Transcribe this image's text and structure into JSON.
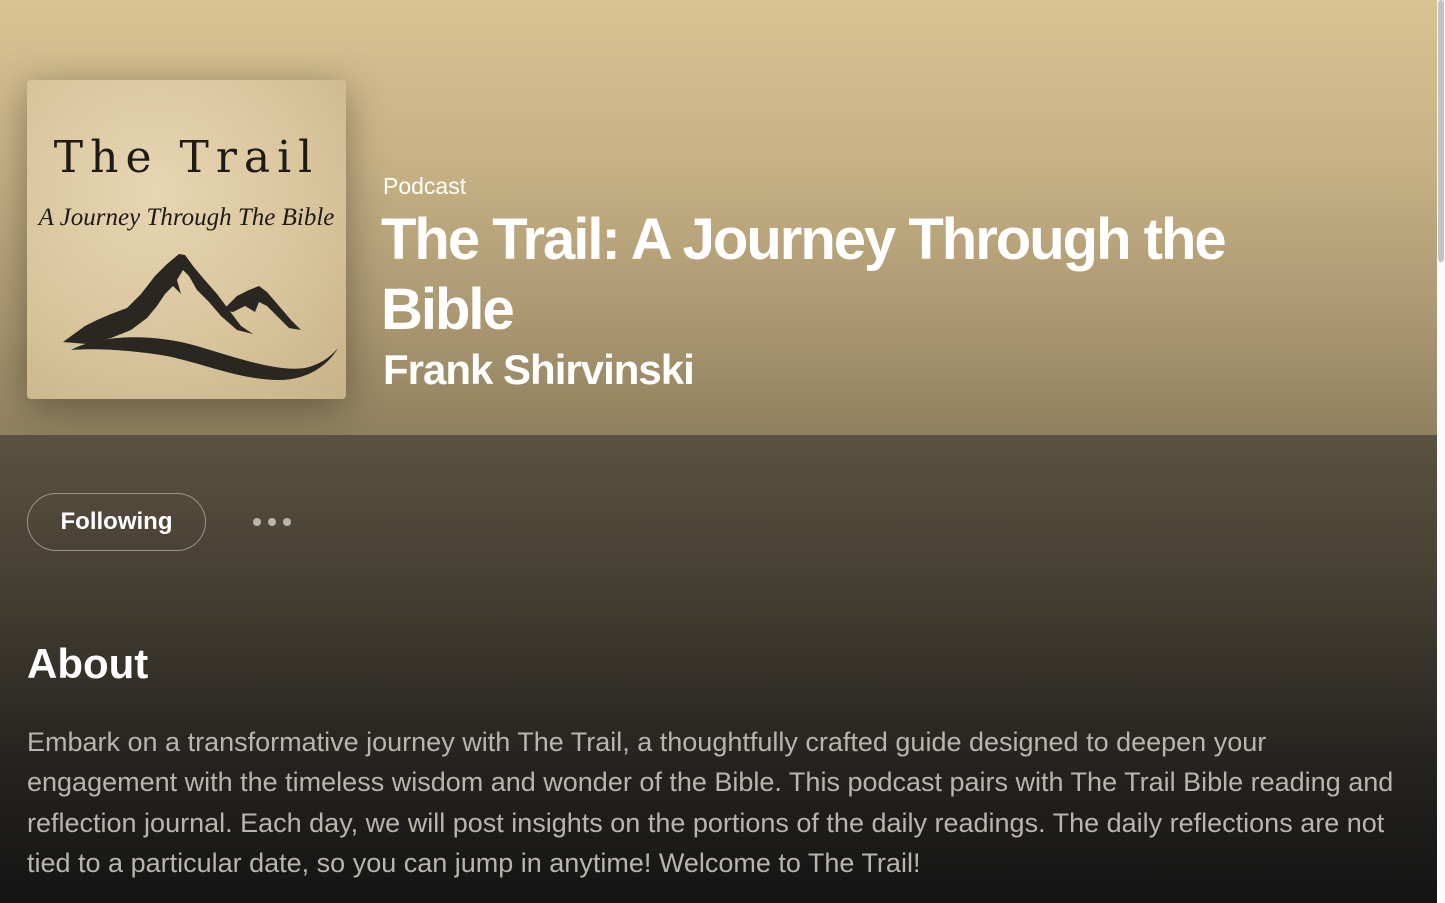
{
  "header": {
    "type_label": "Podcast",
    "title": "The Trail: A Journey Through the Bible",
    "author": "Frank Shirvinski",
    "gradient_top": "#d9c393",
    "gradient_bottom": "#8f805f"
  },
  "cover_art": {
    "title": "The Trail",
    "subtitle": "A Journey Through The Bible",
    "icon": "mountains-icon"
  },
  "actions": {
    "follow_label": "Following",
    "more_icon": "more-options-icon"
  },
  "about": {
    "heading": "About",
    "description": "Embark on a transformative journey with The Trail, a thoughtfully crafted guide designed to deepen your engagement with the timeless wisdom and wonder of the Bible. This podcast pairs with The Trail Bible reading and reflection journal. Each day, we will post insights on the portions of the daily readings. The daily reflections are not tied to a particular date, so you can jump in anytime! Welcome to The Trail!"
  }
}
